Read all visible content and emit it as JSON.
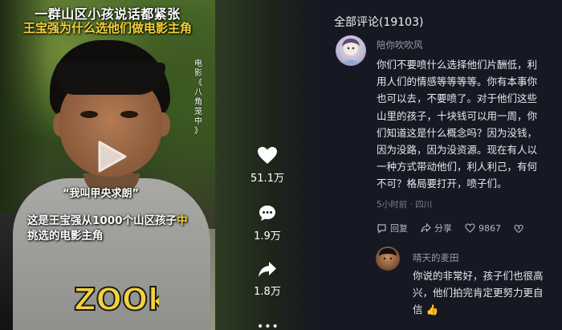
{
  "video": {
    "title": "一群山区小孩说话都紧张",
    "subtitle": "王宝强为什么选他们做电影主角",
    "side_tag": [
      "电",
      "影",
      "《",
      "八",
      "角",
      "笼",
      "中",
      "》"
    ],
    "quote": "“我叫甲央求朗”",
    "caption_part1": "这是王宝强从1000个山区孩子",
    "caption_highlight": "中",
    "caption_part2": "挑选的电影主角",
    "shirt_print": "ZOOk"
  },
  "actions": {
    "likes": "51.1万",
    "comments": "1.9万",
    "shares": "1.8万",
    "more": "•••"
  },
  "comments": {
    "header": "全部评论(19103)",
    "main": {
      "username": "陪你吹吹风",
      "lines": [
        "你们不要喷什么选择他们片酬低，利",
        "用人们的情感等等等等。你有本事你",
        "也可以去，不要喷了。对于他们这些",
        "山里的孩子，十块钱可以用一周，你",
        "们知道这是什么概念吗？因为没钱，",
        "因为没路，因为没资源。现在有人以",
        "一种方式带动他们，利人利己，有何",
        "不可？格局要打开，喷子们。"
      ],
      "meta": "5小时前 · 四川",
      "reply": "回复",
      "share": "分享",
      "likes": "9867"
    },
    "reply": {
      "username": "晴天的麦田",
      "lines": [
        "你说的非常好，孩子们也很高",
        "兴，他们拍完肯定更努力更自",
        "信 👍"
      ]
    }
  }
}
